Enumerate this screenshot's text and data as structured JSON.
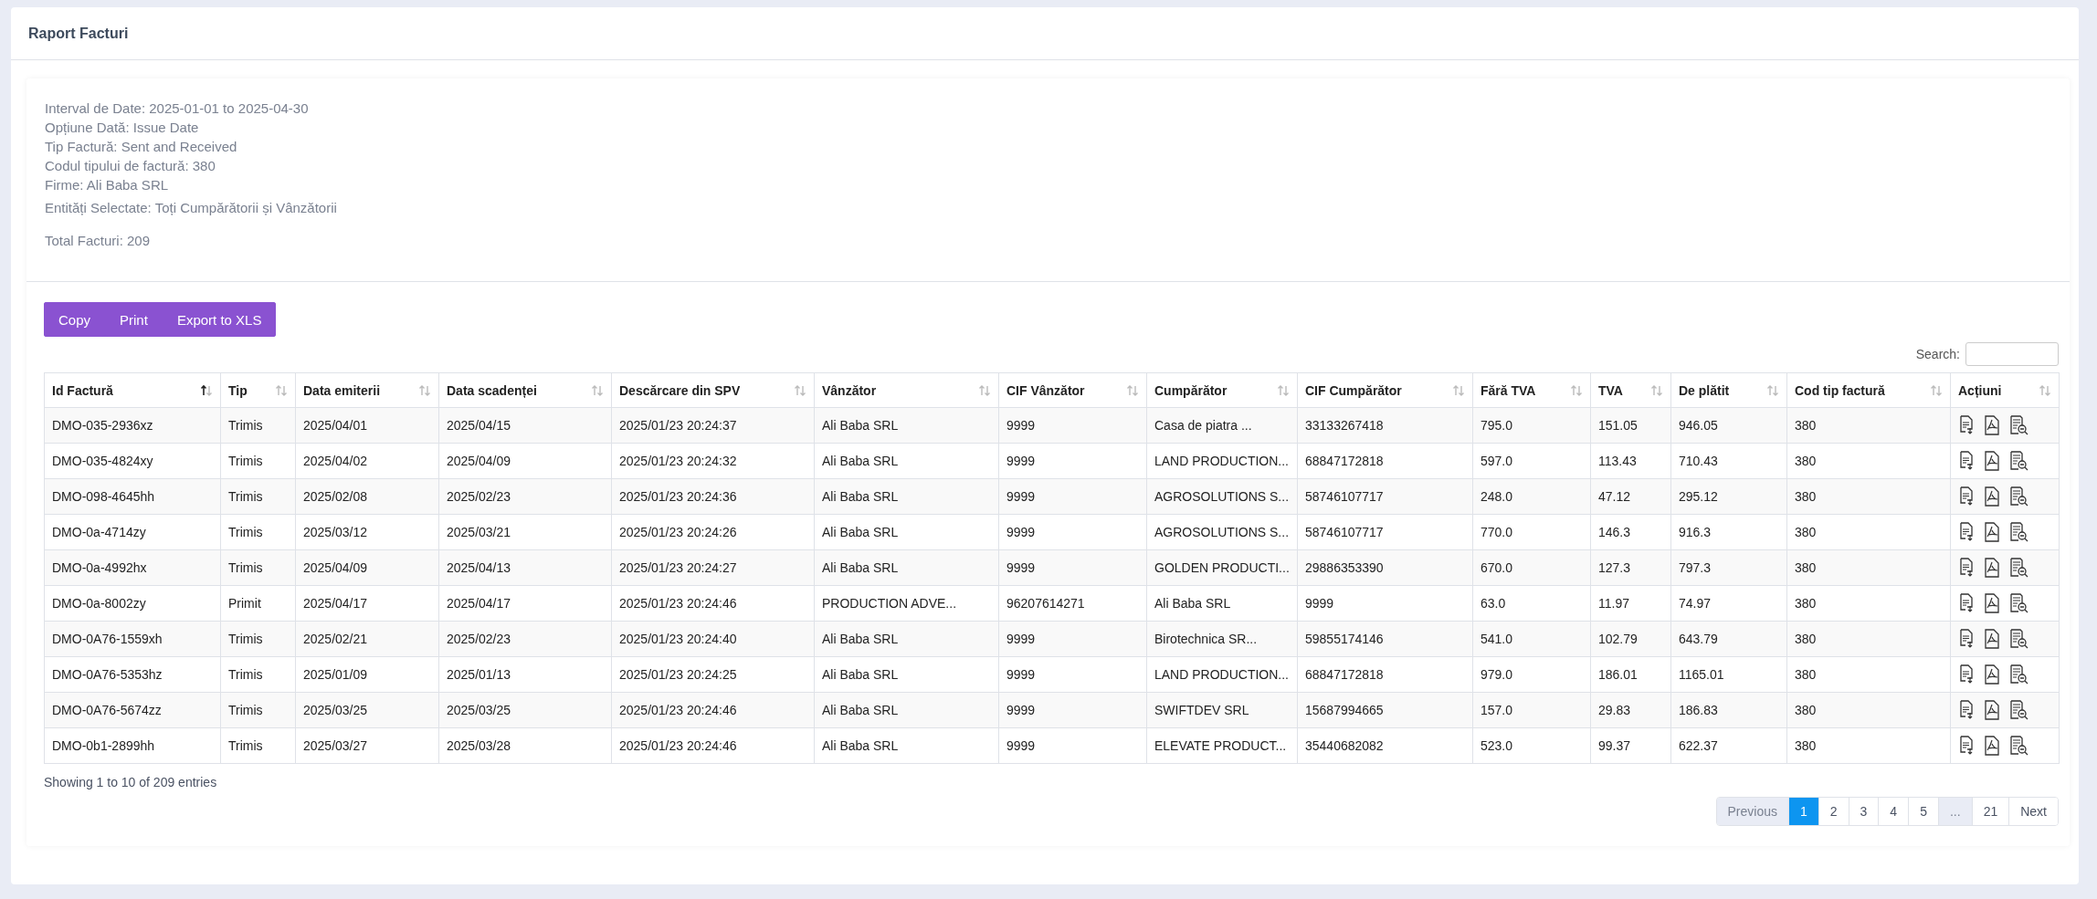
{
  "title": "Raport Facturi",
  "info": {
    "filters": [
      "Interval de Date: 2025-01-01 to 2025-04-30",
      "Opțiune Dată: Issue Date",
      "Tip Factură: Sent and Received",
      "Codul tipului de factură: 380",
      "Firme: Ali Baba SRL"
    ],
    "entities": "Entități Selectate: Toți Cumpărătorii și Vânzătorii",
    "total": "Total Facturi: 209"
  },
  "buttons": [
    "Copy",
    "Print",
    "Export to XLS"
  ],
  "search": {
    "label": "Search:"
  },
  "table": {
    "columns": [
      {
        "label": "Id Factură",
        "sorted": true
      },
      {
        "label": "Tip",
        "sorted": false
      },
      {
        "label": "Data emiterii",
        "sorted": false
      },
      {
        "label": "Data scadenței",
        "sorted": false
      },
      {
        "label": "Descărcare din SPV",
        "sorted": false
      },
      {
        "label": "Vânzător",
        "sorted": false
      },
      {
        "label": "CIF Vânzător",
        "sorted": false
      },
      {
        "label": "Cumpărător",
        "sorted": false
      },
      {
        "label": "CIF Cumpărător",
        "sorted": false
      },
      {
        "label": "Fără TVA",
        "sorted": false
      },
      {
        "label": "TVA",
        "sorted": false
      },
      {
        "label": "De plătit",
        "sorted": false
      },
      {
        "label": "Cod tip factură",
        "sorted": false
      },
      {
        "label": "Acțiuni",
        "sorted": false
      }
    ],
    "rows": [
      [
        "DMO-035-2936xz",
        "Trimis",
        "2025/04/01",
        "2025/04/15",
        "2025/01/23 20:24:37",
        "Ali Baba SRL",
        "9999",
        "Casa de piatra ...",
        "33133267418",
        "795.0",
        "151.05",
        "946.05",
        "380"
      ],
      [
        "DMO-035-4824xy",
        "Trimis",
        "2025/04/02",
        "2025/04/09",
        "2025/01/23 20:24:32",
        "Ali Baba SRL",
        "9999",
        "LAND PRODUCTION...",
        "68847172818",
        "597.0",
        "113.43",
        "710.43",
        "380"
      ],
      [
        "DMO-098-4645hh",
        "Trimis",
        "2025/02/08",
        "2025/02/23",
        "2025/01/23 20:24:36",
        "Ali Baba SRL",
        "9999",
        "AGROSOLUTIONS S...",
        "58746107717",
        "248.0",
        "47.12",
        "295.12",
        "380"
      ],
      [
        "DMO-0a-4714zy",
        "Trimis",
        "2025/03/12",
        "2025/03/21",
        "2025/01/23 20:24:26",
        "Ali Baba SRL",
        "9999",
        "AGROSOLUTIONS S...",
        "58746107717",
        "770.0",
        "146.3",
        "916.3",
        "380"
      ],
      [
        "DMO-0a-4992hx",
        "Trimis",
        "2025/04/09",
        "2025/04/13",
        "2025/01/23 20:24:27",
        "Ali Baba SRL",
        "9999",
        "GOLDEN PRODUCTI...",
        "29886353390",
        "670.0",
        "127.3",
        "797.3",
        "380"
      ],
      [
        "DMO-0a-8002zy",
        "Primit",
        "2025/04/17",
        "2025/04/17",
        "2025/01/23 20:24:46",
        "PRODUCTION ADVE...",
        "96207614271",
        "Ali Baba SRL",
        "9999",
        "63.0",
        "11.97",
        "74.97",
        "380"
      ],
      [
        "DMO-0A76-1559xh",
        "Trimis",
        "2025/02/21",
        "2025/02/23",
        "2025/01/23 20:24:40",
        "Ali Baba SRL",
        "9999",
        "Birotechnica SR...",
        "59855174146",
        "541.0",
        "102.79",
        "643.79",
        "380"
      ],
      [
        "DMO-0A76-5353hz",
        "Trimis",
        "2025/01/09",
        "2025/01/13",
        "2025/01/23 20:24:25",
        "Ali Baba SRL",
        "9999",
        "LAND PRODUCTION...",
        "68847172818",
        "979.0",
        "186.01",
        "1165.01",
        "380"
      ],
      [
        "DMO-0A76-5674zz",
        "Trimis",
        "2025/03/25",
        "2025/03/25",
        "2025/01/23 20:24:46",
        "Ali Baba SRL",
        "9999",
        "SWIFTDEV SRL",
        "15687994665",
        "157.0",
        "29.83",
        "186.83",
        "380"
      ],
      [
        "DMO-0b1-2899hh",
        "Trimis",
        "2025/03/27",
        "2025/03/28",
        "2025/01/23 20:24:46",
        "Ali Baba SRL",
        "9999",
        "ELEVATE PRODUCT...",
        "35440682082",
        "523.0",
        "99.37",
        "622.37",
        "380"
      ]
    ]
  },
  "pagination": {
    "info": "Showing 1 to 10 of 209 entries",
    "items": [
      {
        "label": "Previous",
        "selected": false,
        "disabled": true
      },
      {
        "label": "1",
        "selected": true,
        "disabled": false
      },
      {
        "label": "2",
        "selected": false,
        "disabled": false
      },
      {
        "label": "3",
        "selected": false,
        "disabled": false
      },
      {
        "label": "4",
        "selected": false,
        "disabled": false
      },
      {
        "label": "5",
        "selected": false,
        "disabled": false
      },
      {
        "label": "...",
        "selected": false,
        "disabled": true
      },
      {
        "label": "21",
        "selected": false,
        "disabled": false
      },
      {
        "label": "Next",
        "selected": false,
        "disabled": false
      }
    ]
  }
}
